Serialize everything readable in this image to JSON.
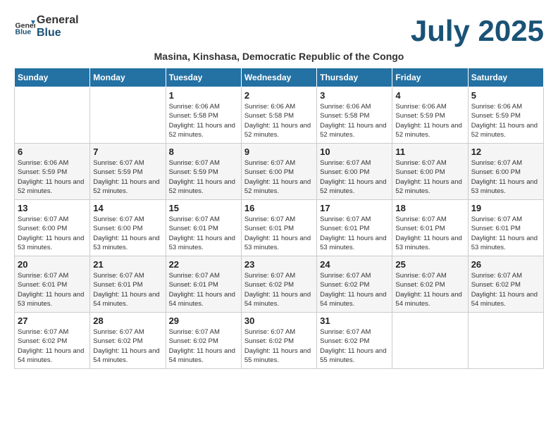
{
  "header": {
    "logo_general": "General",
    "logo_blue": "Blue",
    "month_title": "July 2025",
    "subtitle": "Masina, Kinshasa, Democratic Republic of the Congo"
  },
  "weekdays": [
    "Sunday",
    "Monday",
    "Tuesday",
    "Wednesday",
    "Thursday",
    "Friday",
    "Saturday"
  ],
  "weeks": [
    [
      {
        "day": "",
        "info": ""
      },
      {
        "day": "",
        "info": ""
      },
      {
        "day": "1",
        "info": "Sunrise: 6:06 AM\nSunset: 5:58 PM\nDaylight: 11 hours and 52 minutes."
      },
      {
        "day": "2",
        "info": "Sunrise: 6:06 AM\nSunset: 5:58 PM\nDaylight: 11 hours and 52 minutes."
      },
      {
        "day": "3",
        "info": "Sunrise: 6:06 AM\nSunset: 5:58 PM\nDaylight: 11 hours and 52 minutes."
      },
      {
        "day": "4",
        "info": "Sunrise: 6:06 AM\nSunset: 5:59 PM\nDaylight: 11 hours and 52 minutes."
      },
      {
        "day": "5",
        "info": "Sunrise: 6:06 AM\nSunset: 5:59 PM\nDaylight: 11 hours and 52 minutes."
      }
    ],
    [
      {
        "day": "6",
        "info": "Sunrise: 6:06 AM\nSunset: 5:59 PM\nDaylight: 11 hours and 52 minutes."
      },
      {
        "day": "7",
        "info": "Sunrise: 6:07 AM\nSunset: 5:59 PM\nDaylight: 11 hours and 52 minutes."
      },
      {
        "day": "8",
        "info": "Sunrise: 6:07 AM\nSunset: 5:59 PM\nDaylight: 11 hours and 52 minutes."
      },
      {
        "day": "9",
        "info": "Sunrise: 6:07 AM\nSunset: 6:00 PM\nDaylight: 11 hours and 52 minutes."
      },
      {
        "day": "10",
        "info": "Sunrise: 6:07 AM\nSunset: 6:00 PM\nDaylight: 11 hours and 52 minutes."
      },
      {
        "day": "11",
        "info": "Sunrise: 6:07 AM\nSunset: 6:00 PM\nDaylight: 11 hours and 52 minutes."
      },
      {
        "day": "12",
        "info": "Sunrise: 6:07 AM\nSunset: 6:00 PM\nDaylight: 11 hours and 53 minutes."
      }
    ],
    [
      {
        "day": "13",
        "info": "Sunrise: 6:07 AM\nSunset: 6:00 PM\nDaylight: 11 hours and 53 minutes."
      },
      {
        "day": "14",
        "info": "Sunrise: 6:07 AM\nSunset: 6:00 PM\nDaylight: 11 hours and 53 minutes."
      },
      {
        "day": "15",
        "info": "Sunrise: 6:07 AM\nSunset: 6:01 PM\nDaylight: 11 hours and 53 minutes."
      },
      {
        "day": "16",
        "info": "Sunrise: 6:07 AM\nSunset: 6:01 PM\nDaylight: 11 hours and 53 minutes."
      },
      {
        "day": "17",
        "info": "Sunrise: 6:07 AM\nSunset: 6:01 PM\nDaylight: 11 hours and 53 minutes."
      },
      {
        "day": "18",
        "info": "Sunrise: 6:07 AM\nSunset: 6:01 PM\nDaylight: 11 hours and 53 minutes."
      },
      {
        "day": "19",
        "info": "Sunrise: 6:07 AM\nSunset: 6:01 PM\nDaylight: 11 hours and 53 minutes."
      }
    ],
    [
      {
        "day": "20",
        "info": "Sunrise: 6:07 AM\nSunset: 6:01 PM\nDaylight: 11 hours and 53 minutes."
      },
      {
        "day": "21",
        "info": "Sunrise: 6:07 AM\nSunset: 6:01 PM\nDaylight: 11 hours and 54 minutes."
      },
      {
        "day": "22",
        "info": "Sunrise: 6:07 AM\nSunset: 6:01 PM\nDaylight: 11 hours and 54 minutes."
      },
      {
        "day": "23",
        "info": "Sunrise: 6:07 AM\nSunset: 6:02 PM\nDaylight: 11 hours and 54 minutes."
      },
      {
        "day": "24",
        "info": "Sunrise: 6:07 AM\nSunset: 6:02 PM\nDaylight: 11 hours and 54 minutes."
      },
      {
        "day": "25",
        "info": "Sunrise: 6:07 AM\nSunset: 6:02 PM\nDaylight: 11 hours and 54 minutes."
      },
      {
        "day": "26",
        "info": "Sunrise: 6:07 AM\nSunset: 6:02 PM\nDaylight: 11 hours and 54 minutes."
      }
    ],
    [
      {
        "day": "27",
        "info": "Sunrise: 6:07 AM\nSunset: 6:02 PM\nDaylight: 11 hours and 54 minutes."
      },
      {
        "day": "28",
        "info": "Sunrise: 6:07 AM\nSunset: 6:02 PM\nDaylight: 11 hours and 54 minutes."
      },
      {
        "day": "29",
        "info": "Sunrise: 6:07 AM\nSunset: 6:02 PM\nDaylight: 11 hours and 54 minutes."
      },
      {
        "day": "30",
        "info": "Sunrise: 6:07 AM\nSunset: 6:02 PM\nDaylight: 11 hours and 55 minutes."
      },
      {
        "day": "31",
        "info": "Sunrise: 6:07 AM\nSunset: 6:02 PM\nDaylight: 11 hours and 55 minutes."
      },
      {
        "day": "",
        "info": ""
      },
      {
        "day": "",
        "info": ""
      }
    ]
  ]
}
